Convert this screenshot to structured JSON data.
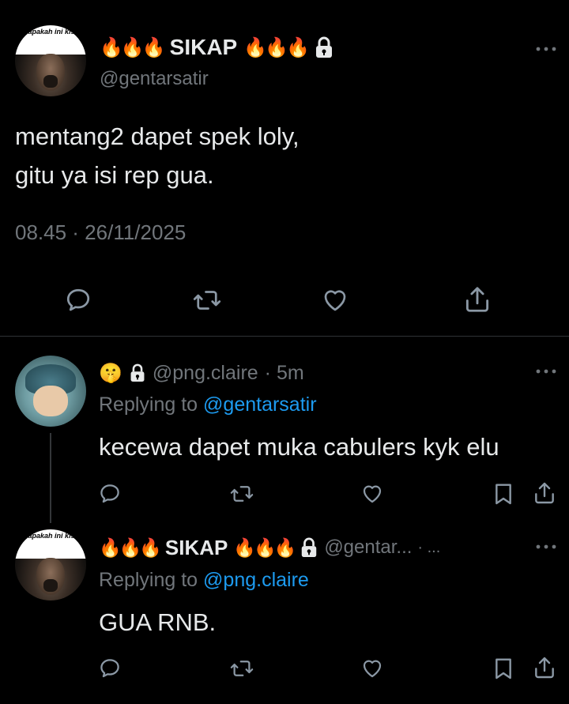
{
  "main_tweet": {
    "avatar_caption": "is, apakah ini kisah",
    "display_name": "SIKAP",
    "fire_left": "🔥🔥🔥",
    "fire_right": "🔥🔥🔥",
    "handle": "@gentarsatir",
    "text_line1": "mentang2 dapet spek loly,",
    "text_line2": "gitu ya isi rep gua.",
    "timestamp": "08.45 · 26/11/2025"
  },
  "reply1": {
    "emoji": "🤫",
    "handle": "@png.claire",
    "time": "· 5m",
    "replying_prefix": "Replying to",
    "replying_to": "@gentarsatir",
    "text": "kecewa dapet muka cabulers kyk elu"
  },
  "reply2": {
    "avatar_caption": "is, apakah ini kisah",
    "display_name": "SIKAP",
    "fire_left": "🔥🔥🔥",
    "fire_right": "🔥🔥🔥",
    "handle": "@gentar...",
    "time": "· ...",
    "replying_prefix": "Replying to",
    "replying_to": "@png.claire",
    "text": "GUA RNB."
  },
  "icons": {
    "more": "more-horizontal-icon",
    "lock": "lock-icon",
    "reply": "reply-icon",
    "retweet": "retweet-icon",
    "like": "heart-icon",
    "share": "share-icon",
    "bookmark": "bookmark-icon"
  },
  "colors": {
    "background": "#000000",
    "text": "#e7e9ea",
    "muted": "#71767b",
    "link": "#1d9bf0",
    "divider": "#2f3336"
  }
}
